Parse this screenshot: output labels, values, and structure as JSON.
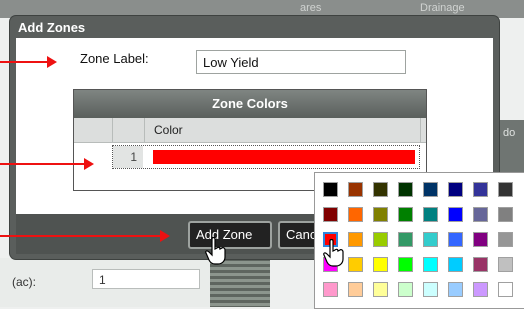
{
  "dialog": {
    "title": "Add Zones",
    "zone_label_text": "Zone Label:",
    "zone_label_value": "Low Yield",
    "zone_colors_header": "Zone Colors",
    "color_column_label": "Color",
    "rows": [
      {
        "number": "1",
        "color": "#ff0000"
      }
    ],
    "add_zone_label": "Add Zone",
    "cancel_label": "Canc"
  },
  "background": {
    "ac_label": "(ac):",
    "ac_value": "1",
    "header_fragments": [
      "ares",
      "Drainage"
    ],
    "right_panel_fragment": "do"
  },
  "palette": {
    "selected_color": "#ff0000",
    "colors": [
      [
        "#000000",
        "#993300",
        "#333300",
        "#003300",
        "#003366",
        "#000080",
        "#333399",
        "#333333"
      ],
      [
        "#800000",
        "#ff6600",
        "#808000",
        "#008000",
        "#008080",
        "#0000ff",
        "#666699",
        "#808080"
      ],
      [
        "#ff0000",
        "#ff9900",
        "#99cc00",
        "#339966",
        "#33cccc",
        "#3366ff",
        "#800080",
        "#969696"
      ],
      [
        "#ff00ff",
        "#ffcc00",
        "#ffff00",
        "#00ff00",
        "#00ffff",
        "#00ccff",
        "#993366",
        "#c0c0c0"
      ],
      [
        "#ff99cc",
        "#ffcc99",
        "#ffff99",
        "#ccffcc",
        "#ccffff",
        "#99ccff",
        "#cc99ff",
        "#ffffff"
      ]
    ]
  },
  "annotation_color": "#ee1111"
}
